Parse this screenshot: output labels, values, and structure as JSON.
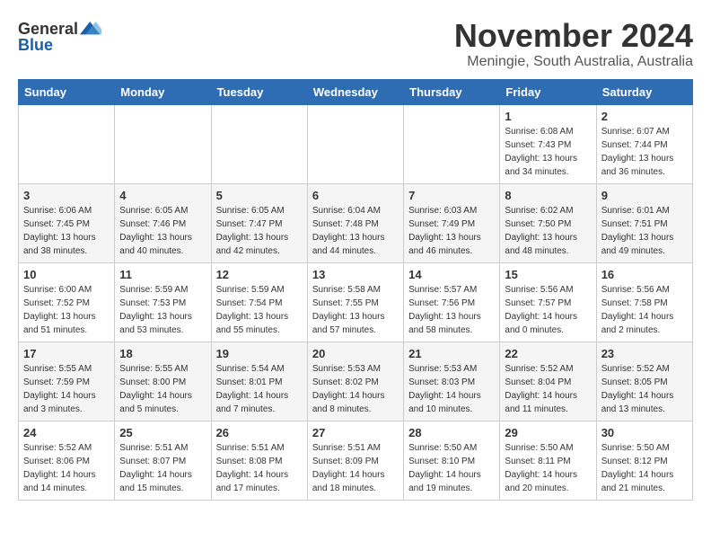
{
  "header": {
    "logo_general": "General",
    "logo_blue": "Blue",
    "month_title": "November 2024",
    "location": "Meningie, South Australia, Australia"
  },
  "calendar": {
    "days_of_week": [
      "Sunday",
      "Monday",
      "Tuesday",
      "Wednesday",
      "Thursday",
      "Friday",
      "Saturday"
    ],
    "weeks": [
      [
        {
          "day": "",
          "info": ""
        },
        {
          "day": "",
          "info": ""
        },
        {
          "day": "",
          "info": ""
        },
        {
          "day": "",
          "info": ""
        },
        {
          "day": "",
          "info": ""
        },
        {
          "day": "1",
          "info": "Sunrise: 6:08 AM\nSunset: 7:43 PM\nDaylight: 13 hours\nand 34 minutes."
        },
        {
          "day": "2",
          "info": "Sunrise: 6:07 AM\nSunset: 7:44 PM\nDaylight: 13 hours\nand 36 minutes."
        }
      ],
      [
        {
          "day": "3",
          "info": "Sunrise: 6:06 AM\nSunset: 7:45 PM\nDaylight: 13 hours\nand 38 minutes."
        },
        {
          "day": "4",
          "info": "Sunrise: 6:05 AM\nSunset: 7:46 PM\nDaylight: 13 hours\nand 40 minutes."
        },
        {
          "day": "5",
          "info": "Sunrise: 6:05 AM\nSunset: 7:47 PM\nDaylight: 13 hours\nand 42 minutes."
        },
        {
          "day": "6",
          "info": "Sunrise: 6:04 AM\nSunset: 7:48 PM\nDaylight: 13 hours\nand 44 minutes."
        },
        {
          "day": "7",
          "info": "Sunrise: 6:03 AM\nSunset: 7:49 PM\nDaylight: 13 hours\nand 46 minutes."
        },
        {
          "day": "8",
          "info": "Sunrise: 6:02 AM\nSunset: 7:50 PM\nDaylight: 13 hours\nand 48 minutes."
        },
        {
          "day": "9",
          "info": "Sunrise: 6:01 AM\nSunset: 7:51 PM\nDaylight: 13 hours\nand 49 minutes."
        }
      ],
      [
        {
          "day": "10",
          "info": "Sunrise: 6:00 AM\nSunset: 7:52 PM\nDaylight: 13 hours\nand 51 minutes."
        },
        {
          "day": "11",
          "info": "Sunrise: 5:59 AM\nSunset: 7:53 PM\nDaylight: 13 hours\nand 53 minutes."
        },
        {
          "day": "12",
          "info": "Sunrise: 5:59 AM\nSunset: 7:54 PM\nDaylight: 13 hours\nand 55 minutes."
        },
        {
          "day": "13",
          "info": "Sunrise: 5:58 AM\nSunset: 7:55 PM\nDaylight: 13 hours\nand 57 minutes."
        },
        {
          "day": "14",
          "info": "Sunrise: 5:57 AM\nSunset: 7:56 PM\nDaylight: 13 hours\nand 58 minutes."
        },
        {
          "day": "15",
          "info": "Sunrise: 5:56 AM\nSunset: 7:57 PM\nDaylight: 14 hours\nand 0 minutes."
        },
        {
          "day": "16",
          "info": "Sunrise: 5:56 AM\nSunset: 7:58 PM\nDaylight: 14 hours\nand 2 minutes."
        }
      ],
      [
        {
          "day": "17",
          "info": "Sunrise: 5:55 AM\nSunset: 7:59 PM\nDaylight: 14 hours\nand 3 minutes."
        },
        {
          "day": "18",
          "info": "Sunrise: 5:55 AM\nSunset: 8:00 PM\nDaylight: 14 hours\nand 5 minutes."
        },
        {
          "day": "19",
          "info": "Sunrise: 5:54 AM\nSunset: 8:01 PM\nDaylight: 14 hours\nand 7 minutes."
        },
        {
          "day": "20",
          "info": "Sunrise: 5:53 AM\nSunset: 8:02 PM\nDaylight: 14 hours\nand 8 minutes."
        },
        {
          "day": "21",
          "info": "Sunrise: 5:53 AM\nSunset: 8:03 PM\nDaylight: 14 hours\nand 10 minutes."
        },
        {
          "day": "22",
          "info": "Sunrise: 5:52 AM\nSunset: 8:04 PM\nDaylight: 14 hours\nand 11 minutes."
        },
        {
          "day": "23",
          "info": "Sunrise: 5:52 AM\nSunset: 8:05 PM\nDaylight: 14 hours\nand 13 minutes."
        }
      ],
      [
        {
          "day": "24",
          "info": "Sunrise: 5:52 AM\nSunset: 8:06 PM\nDaylight: 14 hours\nand 14 minutes."
        },
        {
          "day": "25",
          "info": "Sunrise: 5:51 AM\nSunset: 8:07 PM\nDaylight: 14 hours\nand 15 minutes."
        },
        {
          "day": "26",
          "info": "Sunrise: 5:51 AM\nSunset: 8:08 PM\nDaylight: 14 hours\nand 17 minutes."
        },
        {
          "day": "27",
          "info": "Sunrise: 5:51 AM\nSunset: 8:09 PM\nDaylight: 14 hours\nand 18 minutes."
        },
        {
          "day": "28",
          "info": "Sunrise: 5:50 AM\nSunset: 8:10 PM\nDaylight: 14 hours\nand 19 minutes."
        },
        {
          "day": "29",
          "info": "Sunrise: 5:50 AM\nSunset: 8:11 PM\nDaylight: 14 hours\nand 20 minutes."
        },
        {
          "day": "30",
          "info": "Sunrise: 5:50 AM\nSunset: 8:12 PM\nDaylight: 14 hours\nand 21 minutes."
        }
      ]
    ]
  }
}
